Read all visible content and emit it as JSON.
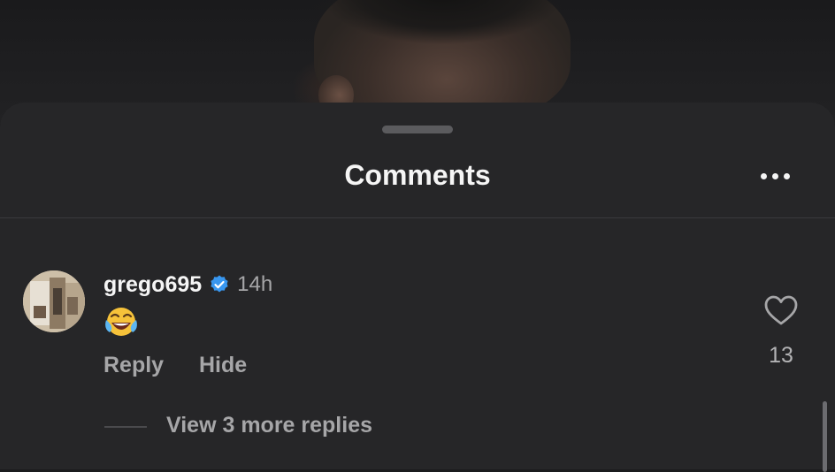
{
  "sheet": {
    "title": "Comments",
    "more_icon": "more-horizontal-icon"
  },
  "comment": {
    "username": "grego695",
    "verified": true,
    "verified_icon": "verified-badge-icon",
    "verified_color": "#3897f0",
    "timestamp": "14h",
    "body_emoji": "face-with-tears-of-joy",
    "actions": {
      "reply_label": "Reply",
      "hide_label": "Hide"
    },
    "like_icon": "heart-outline-icon",
    "like_count": "13",
    "view_replies_label": "View 3 more replies"
  },
  "colors": {
    "sheet_background": "#262628",
    "primary_text": "#f5f5f5",
    "secondary_text": "#a6a6a8"
  }
}
